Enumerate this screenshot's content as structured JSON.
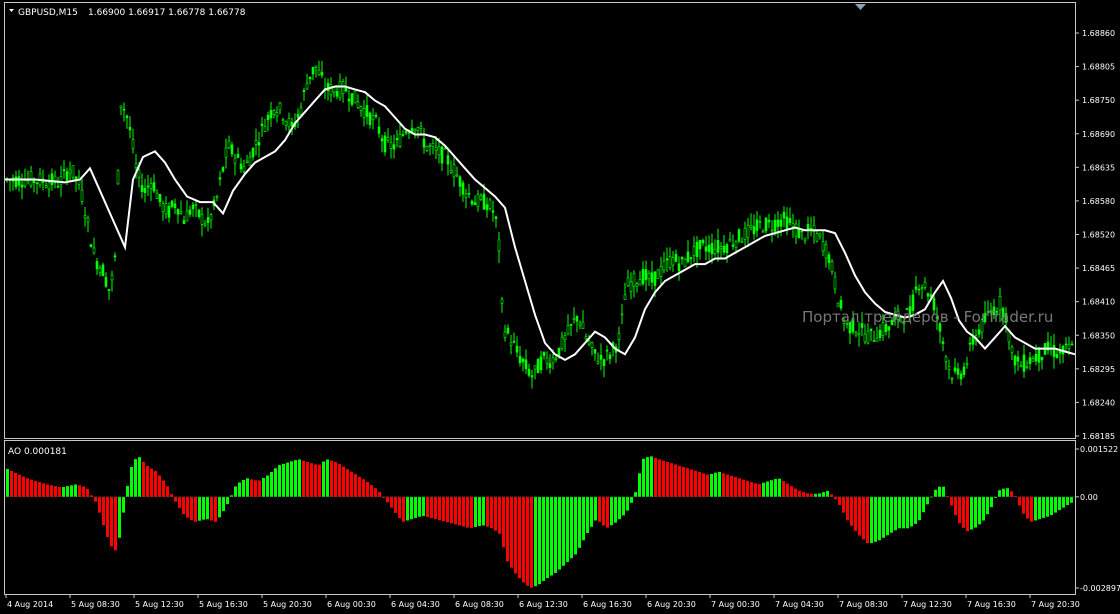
{
  "window": {
    "header_label": "GBPUSD,M15",
    "header_values": "1.66900 1.66917 1.66778 1.66778",
    "watermark": "Портал трейдеров - ForTrader.ru"
  },
  "chart_data": [
    {
      "type": "candlestick",
      "symbol": "GBPUSD",
      "timeframe": "M15",
      "ohlc": {
        "open": 1.669,
        "high": 1.66917,
        "low": 1.66778,
        "close": 1.66778
      },
      "ylim": [
        1.68185,
        1.689
      ],
      "ytick_labels": [
        "1.68860",
        "1.68805",
        "1.68750",
        "1.68690",
        "1.68635",
        "1.68580",
        "1.68520",
        "1.68465",
        "1.68410",
        "1.68350",
        "1.68295",
        "1.68240",
        "1.68185"
      ],
      "xtick_labels": [
        "4 Aug 2014",
        "5 Aug 08:30",
        "5 Aug 12:30",
        "5 Aug 16:30",
        "5 Aug 20:30",
        "6 Aug 00:30",
        "6 Aug 04:30",
        "6 Aug 08:30",
        "6 Aug 12:30",
        "6 Aug 16:30",
        "6 Aug 20:30",
        "7 Aug 00:30",
        "7 Aug 04:30",
        "7 Aug 08:30",
        "7 Aug 12:30",
        "7 Aug 16:30",
        "7 Aug 20:30"
      ],
      "candle_color": "#00ff00",
      "ma_color": "#ffffff",
      "price_path": [
        [
          0,
          1.6864
        ],
        [
          30,
          1.6864
        ],
        [
          60,
          1.68635
        ],
        [
          70,
          1.6866
        ],
        [
          80,
          1.6863
        ],
        [
          88,
          1.6856
        ],
        [
          95,
          1.685
        ],
        [
          103,
          1.6848
        ],
        [
          110,
          1.6844
        ],
        [
          116,
          1.6851
        ],
        [
          120,
          1.6878
        ],
        [
          126,
          1.6876
        ],
        [
          131,
          1.6872
        ],
        [
          137,
          1.6865
        ],
        [
          145,
          1.6862
        ],
        [
          152,
          1.6864
        ],
        [
          160,
          1.686
        ],
        [
          168,
          1.6858
        ],
        [
          176,
          1.686
        ],
        [
          184,
          1.6857
        ],
        [
          192,
          1.6859
        ],
        [
          200,
          1.68575
        ],
        [
          208,
          1.6856
        ],
        [
          216,
          1.686
        ],
        [
          222,
          1.6865
        ],
        [
          228,
          1.687
        ],
        [
          236,
          1.6868
        ],
        [
          245,
          1.6866
        ],
        [
          255,
          1.687
        ],
        [
          265,
          1.6874
        ],
        [
          274,
          1.6877
        ],
        [
          282,
          1.6876
        ],
        [
          292,
          1.6873
        ],
        [
          300,
          1.6876
        ],
        [
          308,
          1.6882
        ],
        [
          316,
          1.6884
        ],
        [
          326,
          1.688
        ],
        [
          336,
          1.688
        ],
        [
          346,
          1.688
        ],
        [
          356,
          1.6878
        ],
        [
          366,
          1.6876
        ],
        [
          376,
          1.6874
        ],
        [
          386,
          1.687
        ],
        [
          396,
          1.687
        ],
        [
          406,
          1.6873
        ],
        [
          416,
          1.6874
        ],
        [
          426,
          1.687
        ],
        [
          436,
          1.6869
        ],
        [
          446,
          1.6868
        ],
        [
          456,
          1.6865
        ],
        [
          466,
          1.6862
        ],
        [
          476,
          1.686
        ],
        [
          486,
          1.686
        ],
        [
          495,
          1.6858
        ],
        [
          499,
          1.6852
        ],
        [
          503,
          1.6838
        ],
        [
          510,
          1.6836
        ],
        [
          518,
          1.6833
        ],
        [
          525,
          1.6831
        ],
        [
          533,
          1.6829
        ],
        [
          542,
          1.6832
        ],
        [
          552,
          1.6832
        ],
        [
          560,
          1.6834
        ],
        [
          566,
          1.6836
        ],
        [
          572,
          1.6838
        ],
        [
          578,
          1.684
        ],
        [
          586,
          1.6836
        ],
        [
          594,
          1.6833
        ],
        [
          602,
          1.6832
        ],
        [
          610,
          1.6833
        ],
        [
          620,
          1.6836
        ],
        [
          626,
          1.6845
        ],
        [
          634,
          1.6846
        ],
        [
          642,
          1.6847
        ],
        [
          652,
          1.6846
        ],
        [
          662,
          1.6848
        ],
        [
          672,
          1.685
        ],
        [
          682,
          1.6849
        ],
        [
          692,
          1.6851
        ],
        [
          702,
          1.6852
        ],
        [
          712,
          1.6852
        ],
        [
          722,
          1.6852
        ],
        [
          732,
          1.6853
        ],
        [
          742,
          1.6854
        ],
        [
          752,
          1.6855
        ],
        [
          762,
          1.6856
        ],
        [
          772,
          1.6856
        ],
        [
          782,
          1.6857
        ],
        [
          792,
          1.6856
        ],
        [
          802,
          1.6854
        ],
        [
          812,
          1.6855
        ],
        [
          822,
          1.6853
        ],
        [
          830,
          1.685
        ],
        [
          838,
          1.6843
        ],
        [
          846,
          1.6838
        ],
        [
          854,
          1.6838
        ],
        [
          862,
          1.6837
        ],
        [
          870,
          1.6836
        ],
        [
          880,
          1.6837
        ],
        [
          890,
          1.6838
        ],
        [
          900,
          1.684
        ],
        [
          910,
          1.684
        ],
        [
          918,
          1.6846
        ],
        [
          926,
          1.6845
        ],
        [
          934,
          1.6842
        ],
        [
          942,
          1.6836
        ],
        [
          950,
          1.683
        ],
        [
          958,
          1.6829
        ],
        [
          966,
          1.6831
        ],
        [
          974,
          1.6836
        ],
        [
          982,
          1.6838
        ],
        [
          992,
          1.6841
        ],
        [
          1000,
          1.6842
        ],
        [
          1006,
          1.684
        ],
        [
          1012,
          1.6833
        ],
        [
          1020,
          1.6831
        ],
        [
          1030,
          1.6832
        ],
        [
          1040,
          1.6833
        ],
        [
          1050,
          1.6834
        ],
        [
          1060,
          1.6833
        ],
        [
          1070,
          1.6834
        ]
      ],
      "ma_path": [
        [
          0,
          1.6864
        ],
        [
          30,
          1.6864
        ],
        [
          60,
          1.68635
        ],
        [
          75,
          1.6864
        ],
        [
          85,
          1.6866
        ],
        [
          95,
          1.6862
        ],
        [
          105,
          1.6858
        ],
        [
          115,
          1.6854
        ],
        [
          120,
          1.6852
        ],
        [
          128,
          1.6864
        ],
        [
          138,
          1.6868
        ],
        [
          150,
          1.6869
        ],
        [
          160,
          1.6867
        ],
        [
          170,
          1.6864
        ],
        [
          182,
          1.6861
        ],
        [
          195,
          1.686
        ],
        [
          208,
          1.686
        ],
        [
          218,
          1.6858
        ],
        [
          228,
          1.6862
        ],
        [
          240,
          1.6865
        ],
        [
          250,
          1.6867
        ],
        [
          260,
          1.6868
        ],
        [
          270,
          1.6869
        ],
        [
          280,
          1.6871
        ],
        [
          290,
          1.6874
        ],
        [
          300,
          1.6876
        ],
        [
          310,
          1.6878
        ],
        [
          320,
          1.688
        ],
        [
          330,
          1.68805
        ],
        [
          340,
          1.68805
        ],
        [
          350,
          1.688
        ],
        [
          360,
          1.68795
        ],
        [
          370,
          1.6878
        ],
        [
          380,
          1.6877
        ],
        [
          390,
          1.6875
        ],
        [
          400,
          1.6873
        ],
        [
          410,
          1.6872
        ],
        [
          420,
          1.6872
        ],
        [
          430,
          1.68715
        ],
        [
          440,
          1.687
        ],
        [
          450,
          1.6868
        ],
        [
          460,
          1.6866
        ],
        [
          470,
          1.6864
        ],
        [
          480,
          1.68625
        ],
        [
          490,
          1.6861
        ],
        [
          500,
          1.6859
        ],
        [
          510,
          1.6852
        ],
        [
          520,
          1.6846
        ],
        [
          530,
          1.684
        ],
        [
          540,
          1.6835
        ],
        [
          550,
          1.6833
        ],
        [
          560,
          1.6832
        ],
        [
          570,
          1.6833
        ],
        [
          580,
          1.6835
        ],
        [
          590,
          1.6837
        ],
        [
          600,
          1.6836
        ],
        [
          610,
          1.6834
        ],
        [
          620,
          1.6833
        ],
        [
          630,
          1.6836
        ],
        [
          640,
          1.6841
        ],
        [
          650,
          1.6844
        ],
        [
          660,
          1.6846
        ],
        [
          670,
          1.6847
        ],
        [
          680,
          1.6848
        ],
        [
          690,
          1.6849
        ],
        [
          700,
          1.6849
        ],
        [
          710,
          1.685
        ],
        [
          720,
          1.685
        ],
        [
          730,
          1.6851
        ],
        [
          740,
          1.6852
        ],
        [
          750,
          1.6853
        ],
        [
          760,
          1.6854
        ],
        [
          770,
          1.68545
        ],
        [
          780,
          1.6855
        ],
        [
          790,
          1.68555
        ],
        [
          800,
          1.6855
        ],
        [
          810,
          1.6855
        ],
        [
          820,
          1.6855
        ],
        [
          830,
          1.68545
        ],
        [
          840,
          1.6851
        ],
        [
          850,
          1.6847
        ],
        [
          860,
          1.6844
        ],
        [
          870,
          1.6842
        ],
        [
          880,
          1.68405
        ],
        [
          890,
          1.684
        ],
        [
          900,
          1.68395
        ],
        [
          910,
          1.684
        ],
        [
          920,
          1.6841
        ],
        [
          930,
          1.6844
        ],
        [
          938,
          1.6846
        ],
        [
          946,
          1.6843
        ],
        [
          954,
          1.6839
        ],
        [
          962,
          1.6837
        ],
        [
          970,
          1.6836
        ],
        [
          980,
          1.6834
        ],
        [
          990,
          1.6836
        ],
        [
          1000,
          1.6838
        ],
        [
          1010,
          1.6836
        ],
        [
          1020,
          1.6835
        ],
        [
          1030,
          1.6834
        ],
        [
          1040,
          1.6834
        ],
        [
          1050,
          1.6834
        ],
        [
          1060,
          1.68335
        ],
        [
          1070,
          1.6833
        ]
      ]
    },
    {
      "type": "histogram",
      "indicator_label": "AO 0.000181",
      "ylim": [
        -0.002897,
        0.001522
      ],
      "ytick_labels": [
        "0.001522",
        "0.00",
        "-0.002897"
      ],
      "up_color": "#00ff00",
      "down_color": "#ff0000",
      "ao_path": [
        [
          0,
          0.0009
        ],
        [
          20,
          0.0006
        ],
        [
          40,
          0.0004
        ],
        [
          55,
          0.0003
        ],
        [
          70,
          0.0004
        ],
        [
          80,
          0.0003
        ],
        [
          90,
          -0.0002
        ],
        [
          100,
          -0.0012
        ],
        [
          108,
          -0.0018
        ],
        [
          114,
          -0.0012
        ],
        [
          120,
          0.0002
        ],
        [
          126,
          0.0011
        ],
        [
          132,
          0.0013
        ],
        [
          140,
          0.001
        ],
        [
          150,
          0.0008
        ],
        [
          160,
          0.0004
        ],
        [
          168,
          -0.0001
        ],
        [
          178,
          -0.0006
        ],
        [
          188,
          -0.0008
        ],
        [
          200,
          -0.0007
        ],
        [
          210,
          -0.0008
        ],
        [
          220,
          -0.0003
        ],
        [
          230,
          0.0004
        ],
        [
          240,
          0.0006
        ],
        [
          252,
          0.0005
        ],
        [
          262,
          0.0007
        ],
        [
          272,
          0.001
        ],
        [
          282,
          0.0011
        ],
        [
          292,
          0.0012
        ],
        [
          302,
          0.0011
        ],
        [
          312,
          0.001
        ],
        [
          320,
          0.0012
        ],
        [
          330,
          0.0011
        ],
        [
          340,
          0.0009
        ],
        [
          350,
          0.0007
        ],
        [
          360,
          0.0005
        ],
        [
          372,
          0.0002
        ],
        [
          384,
          -0.0003
        ],
        [
          396,
          -0.0008
        ],
        [
          406,
          -0.0007
        ],
        [
          416,
          -0.0006
        ],
        [
          428,
          -0.0007
        ],
        [
          440,
          -0.0008
        ],
        [
          452,
          -0.0009
        ],
        [
          464,
          -0.001
        ],
        [
          476,
          -0.0009
        ],
        [
          486,
          -0.001
        ],
        [
          494,
          -0.0012
        ],
        [
          500,
          -0.002
        ],
        [
          508,
          -0.0024
        ],
        [
          516,
          -0.0027
        ],
        [
          524,
          -0.0029
        ],
        [
          532,
          -0.0028
        ],
        [
          540,
          -0.0026
        ],
        [
          550,
          -0.0024
        ],
        [
          560,
          -0.0021
        ],
        [
          570,
          -0.0018
        ],
        [
          580,
          -0.0012
        ],
        [
          590,
          -0.0007
        ],
        [
          600,
          -0.001
        ],
        [
          610,
          -0.0008
        ],
        [
          620,
          -0.0005
        ],
        [
          628,
          0.0
        ],
        [
          636,
          0.0012
        ],
        [
          644,
          0.0013
        ],
        [
          652,
          0.0012
        ],
        [
          662,
          0.0011
        ],
        [
          672,
          0.001
        ],
        [
          682,
          0.0009
        ],
        [
          692,
          0.0008
        ],
        [
          702,
          0.0007
        ],
        [
          712,
          0.0008
        ],
        [
          722,
          0.0007
        ],
        [
          732,
          0.0006
        ],
        [
          742,
          0.0005
        ],
        [
          752,
          0.0004
        ],
        [
          762,
          0.0005
        ],
        [
          772,
          0.0006
        ],
        [
          782,
          0.0004
        ],
        [
          792,
          0.0002
        ],
        [
          802,
          0.0001
        ],
        [
          812,
          0.0001
        ],
        [
          822,
          0.0002
        ],
        [
          832,
          -0.0002
        ],
        [
          842,
          -0.0008
        ],
        [
          852,
          -0.0012
        ],
        [
          862,
          -0.0015
        ],
        [
          872,
          -0.0014
        ],
        [
          882,
          -0.0012
        ],
        [
          892,
          -0.001
        ],
        [
          902,
          -0.001
        ],
        [
          912,
          -0.0008
        ],
        [
          920,
          -0.0003
        ],
        [
          928,
          0.0002
        ],
        [
          936,
          0.0004
        ],
        [
          944,
          -0.0002
        ],
        [
          952,
          -0.0008
        ],
        [
          960,
          -0.0011
        ],
        [
          968,
          -0.001
        ],
        [
          976,
          -0.0008
        ],
        [
          984,
          -0.0004
        ],
        [
          992,
          0.0002
        ],
        [
          1000,
          0.0003
        ],
        [
          1008,
          0.0001
        ],
        [
          1016,
          -0.0005
        ],
        [
          1024,
          -0.0008
        ],
        [
          1034,
          -0.0007
        ],
        [
          1044,
          -0.0006
        ],
        [
          1054,
          -0.0004
        ],
        [
          1064,
          -0.0002
        ],
        [
          1072,
          -0.0001
        ]
      ]
    }
  ]
}
